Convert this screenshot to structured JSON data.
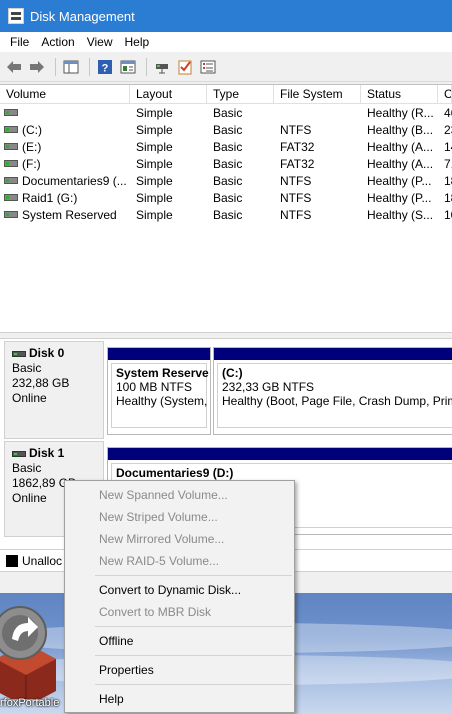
{
  "window": {
    "title": "Disk Management"
  },
  "menu": [
    "File",
    "Action",
    "View",
    "Help"
  ],
  "toolbar": {
    "buttons": [
      "back-arrow-icon",
      "forward-arrow-icon",
      "console-tree-icon",
      "help-icon",
      "properties-icon",
      "connect-disk-icon",
      "checklist-icon",
      "settings-list-icon"
    ]
  },
  "volume_list": {
    "columns": [
      "Volume",
      "Layout",
      "Type",
      "File System",
      "Status",
      "C"
    ],
    "rows": [
      {
        "volume": "",
        "layout": "Simple",
        "type": "Basic",
        "fs": "",
        "status": "Healthy (R...",
        "cap": "46"
      },
      {
        "volume": "(C:)",
        "layout": "Simple",
        "type": "Basic",
        "fs": "NTFS",
        "status": "Healthy (B...",
        "cap": "23"
      },
      {
        "volume": "(E:)",
        "layout": "Simple",
        "type": "Basic",
        "fs": "FAT32",
        "status": "Healthy (A...",
        "cap": "14"
      },
      {
        "volume": "(F:)",
        "layout": "Simple",
        "type": "Basic",
        "fs": "FAT32",
        "status": "Healthy (A...",
        "cap": "7,"
      },
      {
        "volume": "Documentaries9 (...",
        "layout": "Simple",
        "type": "Basic",
        "fs": "NTFS",
        "status": "Healthy (P...",
        "cap": "18"
      },
      {
        "volume": "Raid1 (G:)",
        "layout": "Simple",
        "type": "Basic",
        "fs": "NTFS",
        "status": "Healthy (P...",
        "cap": "18"
      },
      {
        "volume": "System Reserved",
        "layout": "Simple",
        "type": "Basic",
        "fs": "NTFS",
        "status": "Healthy (S...",
        "cap": "10"
      }
    ]
  },
  "disks": [
    {
      "name": "Disk 0",
      "type": "Basic",
      "size": "232,88 GB",
      "state": "Online",
      "partitions": [
        {
          "name": "System Reserve",
          "detail": "100 MB NTFS",
          "status": "Healthy (System,"
        },
        {
          "name": "(C:)",
          "detail": "232,33 GB NTFS",
          "status": "Healthy (Boot, Page File, Crash Dump, Prima"
        }
      ]
    },
    {
      "name": "Disk 1",
      "type": "Basic",
      "size": "1862,89 GB",
      "state": "Online",
      "partitions": [
        {
          "name": "Documentaries9  (D:)",
          "detail": "",
          "status": ""
        }
      ]
    }
  ],
  "legend": {
    "unallocated": "Unalloc"
  },
  "desktop": {
    "icon_label": "rfoxPortable"
  },
  "context_menu": {
    "items": [
      {
        "label": "New Spanned Volume...",
        "enabled": false
      },
      {
        "label": "New Striped Volume...",
        "enabled": false
      },
      {
        "label": "New Mirrored Volume...",
        "enabled": false
      },
      {
        "label": "New RAID-5 Volume...",
        "enabled": false
      },
      {
        "label": "Convert to Dynamic Disk...",
        "enabled": true
      },
      {
        "label": "Convert to MBR Disk",
        "enabled": false
      },
      {
        "label": "Offline",
        "enabled": true
      },
      {
        "label": "Properties",
        "enabled": true
      },
      {
        "label": "Help",
        "enabled": true
      }
    ]
  },
  "colors": {
    "titlebar": "#2b7cd3",
    "partition_bar": "#00007b"
  }
}
